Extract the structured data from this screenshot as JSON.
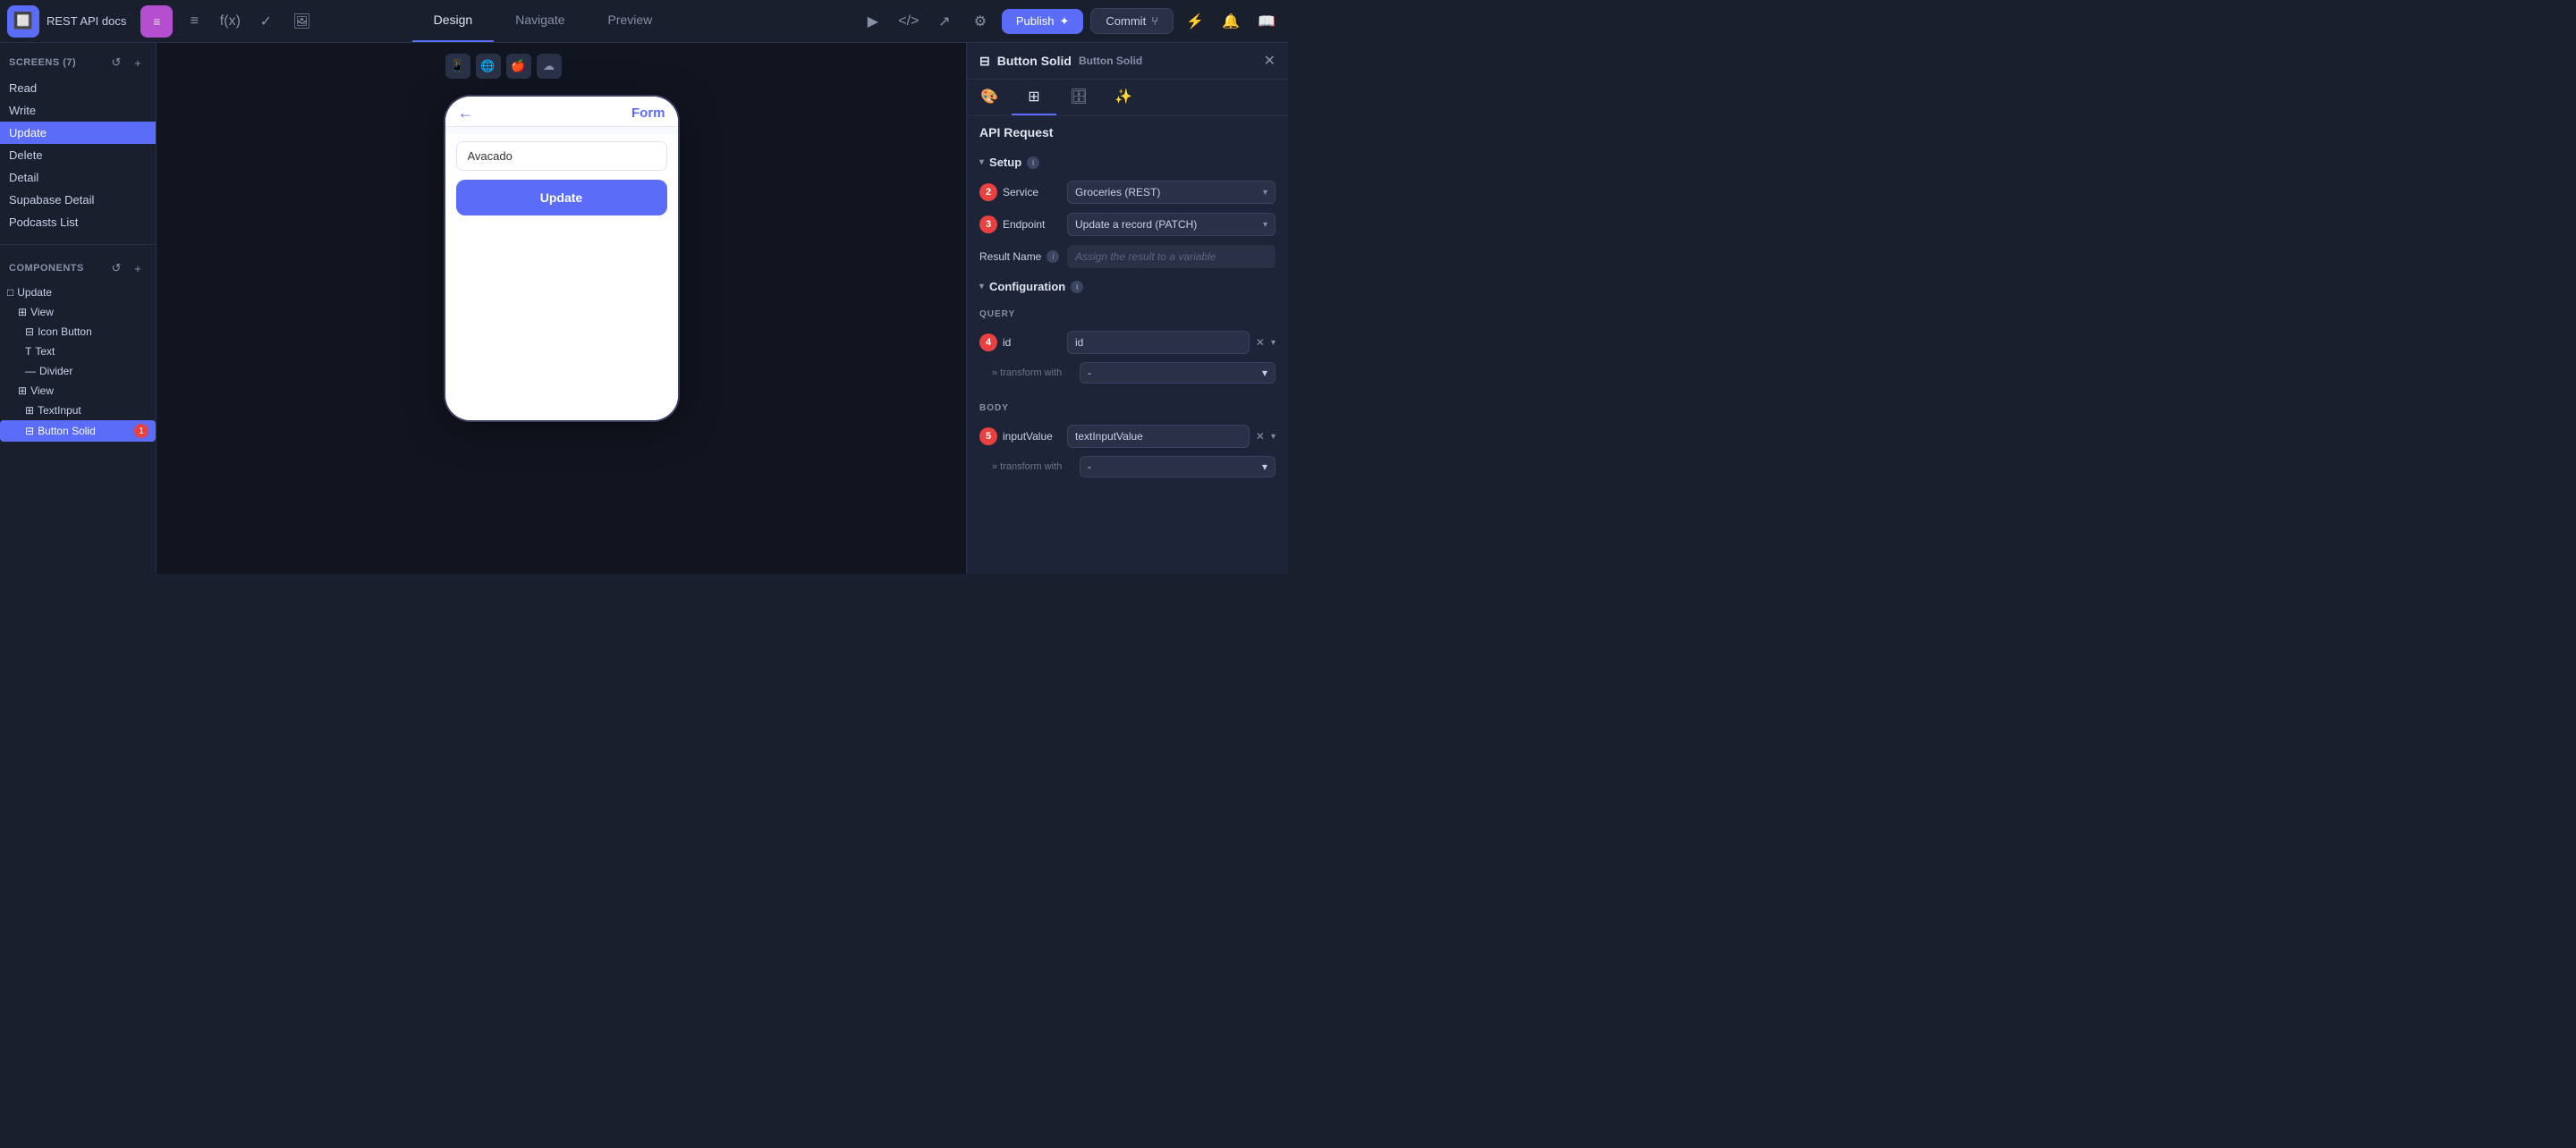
{
  "topbar": {
    "logo": "🔲",
    "appname": "REST API docs",
    "stack_icon": "≡",
    "tabs": [
      {
        "label": "Design",
        "active": true
      },
      {
        "label": "Navigate",
        "active": false
      },
      {
        "label": "Preview",
        "active": false
      }
    ],
    "actions": {
      "play_icon": "▶",
      "code_icon": "</>",
      "export_icon": "↗",
      "settings_icon": "⚙",
      "publish_label": "Publish",
      "commit_label": "Commit",
      "lightning_icon": "⚡",
      "notification_icon": "🔔",
      "book_icon": "📖"
    }
  },
  "left_sidebar": {
    "screens_title": "Screens (7)",
    "screens": [
      {
        "label": "Read",
        "active": false
      },
      {
        "label": "Write",
        "active": false
      },
      {
        "label": "Update",
        "active": true
      },
      {
        "label": "Delete",
        "active": false
      },
      {
        "label": "Detail",
        "active": false
      },
      {
        "label": "Supabase Detail",
        "active": false
      },
      {
        "label": "Podcasts List",
        "active": false
      }
    ],
    "components_title": "Components",
    "components": [
      {
        "label": "Update",
        "indent": 0,
        "icon": "□"
      },
      {
        "label": "View",
        "indent": 1,
        "icon": "⊞"
      },
      {
        "label": "Icon Button",
        "indent": 2,
        "icon": "⊟"
      },
      {
        "label": "Text",
        "indent": 2,
        "icon": "T"
      },
      {
        "label": "Divider",
        "indent": 2,
        "icon": "—"
      },
      {
        "label": "View",
        "indent": 1,
        "icon": "⊞"
      },
      {
        "label": "TextInput",
        "indent": 2,
        "icon": "⊞"
      },
      {
        "label": "Button Solid",
        "indent": 2,
        "icon": "⊟",
        "active": true,
        "badge": "1"
      }
    ]
  },
  "canvas": {
    "toolbar_buttons": [
      {
        "icon": "📱",
        "active": false
      },
      {
        "icon": "🌐",
        "active": false
      },
      {
        "icon": "🍎",
        "active": false
      },
      {
        "icon": "☁",
        "active": false
      }
    ],
    "device": {
      "back_icon": "←",
      "form_title": "Form",
      "input_value": "Avacado",
      "button_label": "Update"
    }
  },
  "right_panel": {
    "title": "Button Solid",
    "subtitle": "Button Solid",
    "close_icon": "✕",
    "panel_tabs": [
      {
        "icon": "🎨",
        "active": false
      },
      {
        "icon": "⊞",
        "active": true
      },
      {
        "icon": "🗄",
        "active": false
      },
      {
        "icon": "✨",
        "active": false
      }
    ],
    "api_request": {
      "header": "API Request",
      "setup_section": "Setup",
      "setup_fields": [
        {
          "step": "2",
          "label": "Service",
          "value": "Groceries (REST)",
          "has_dropdown": true
        },
        {
          "step": "3",
          "label": "Endpoint",
          "value": "Update a record (PATCH)",
          "has_dropdown": true
        }
      ],
      "result_name_label": "Result Name",
      "result_name_placeholder": "Assign the result to a variable",
      "configuration_section": "Configuration",
      "query_label": "QUERY",
      "query_fields": [
        {
          "step": "4",
          "label": "id",
          "value": "id",
          "has_x": true,
          "has_dropdown": true
        }
      ],
      "query_transform_label": "» transform with",
      "query_transform_value": "-",
      "body_label": "BODY",
      "body_fields": [
        {
          "step": "5",
          "label": "inputValue",
          "value": "textInputValue",
          "has_x": true,
          "has_dropdown": true
        }
      ],
      "body_transform_label": "» transform with",
      "body_transform_value": "-"
    }
  }
}
